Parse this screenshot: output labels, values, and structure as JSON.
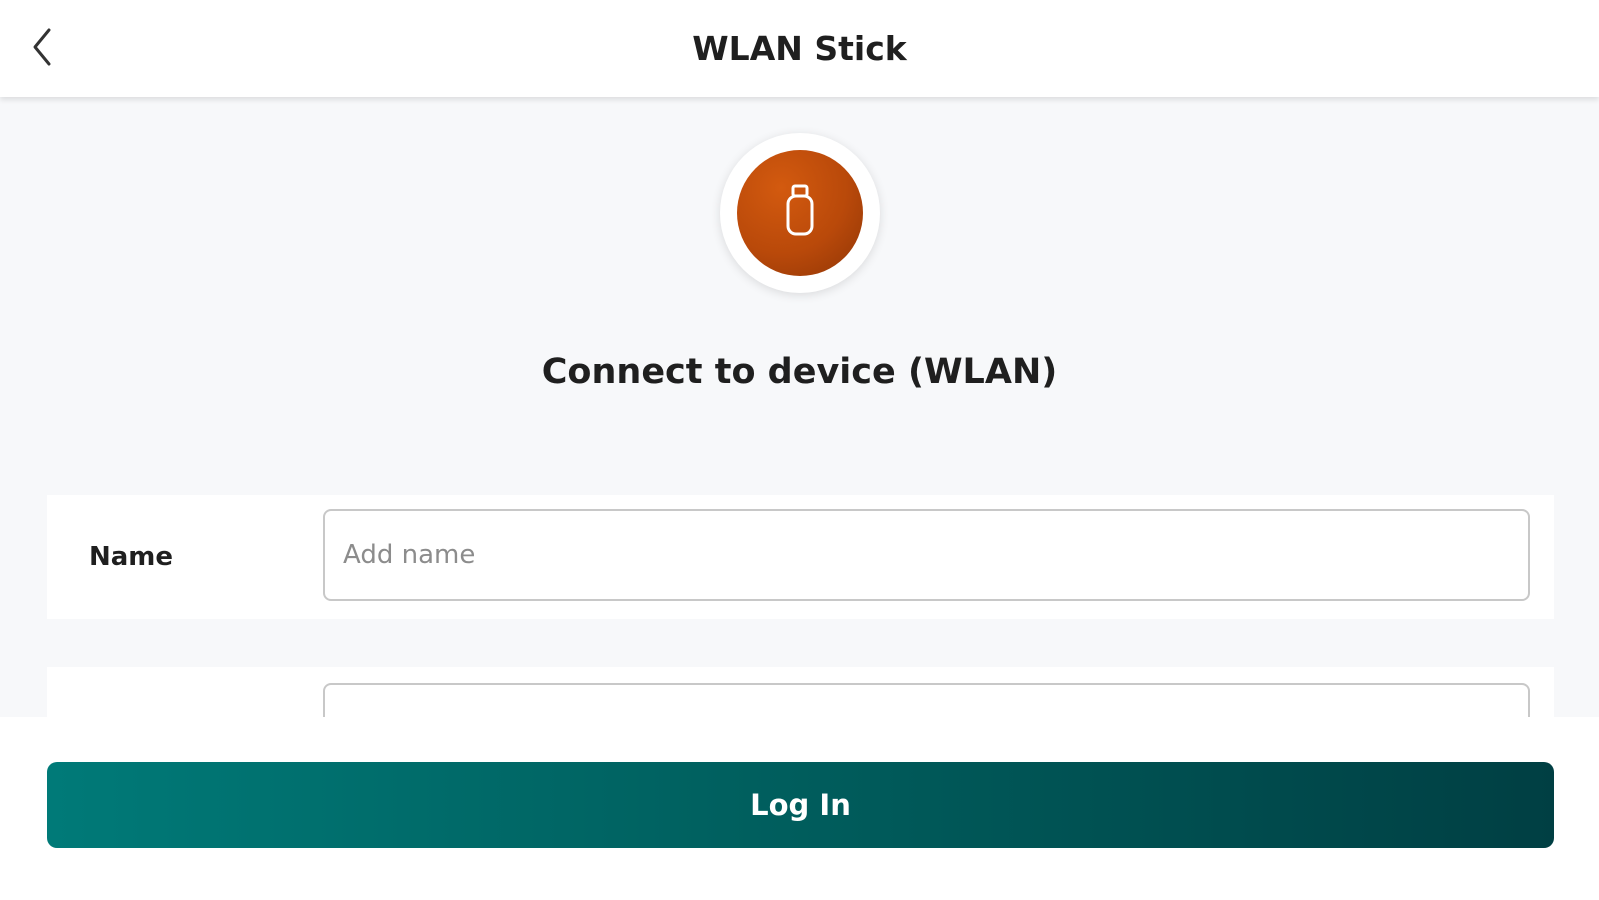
{
  "header": {
    "title": "WLAN Stick",
    "back_icon": "chevron-left-icon"
  },
  "device": {
    "icon": "usb-stick-icon",
    "badge_color": "#c4520c"
  },
  "connect": {
    "title": "Connect to device (WLAN)"
  },
  "form": {
    "name_label": "Name",
    "name_placeholder": "Add name",
    "name_value": ""
  },
  "footer": {
    "login_label": "Log In",
    "button_color_start": "#007a78",
    "button_color_end": "#003f43"
  }
}
